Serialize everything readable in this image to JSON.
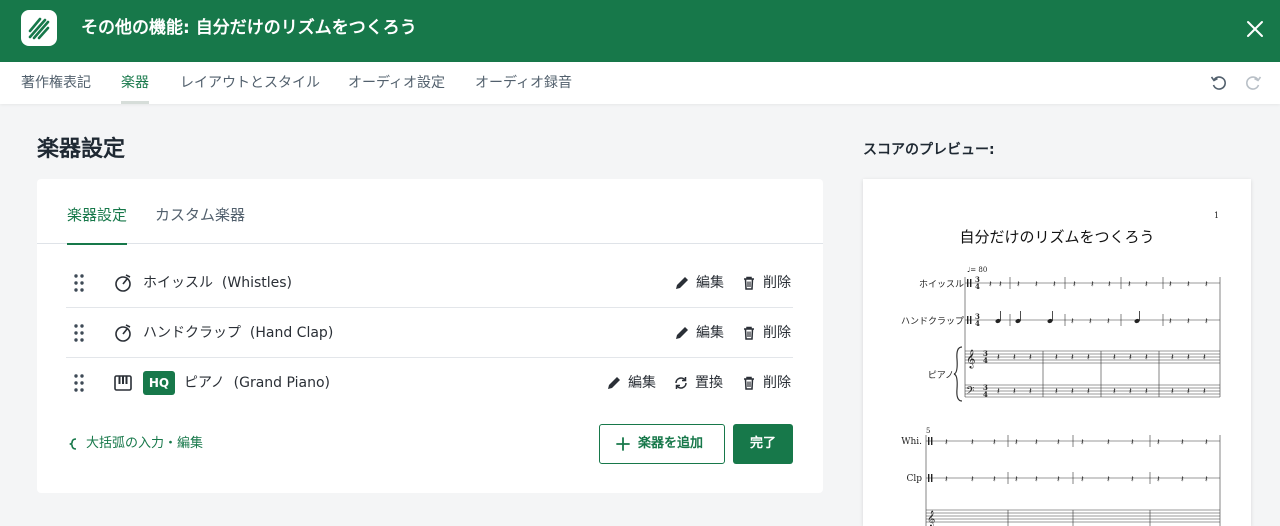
{
  "header": {
    "title": "その他の機能: 自分だけのリズムをつくろう",
    "logo_icon": "score-logo-icon",
    "close_icon": "close-icon",
    "bg_color": "#17784a"
  },
  "tabs": [
    {
      "label": "著作権表記",
      "active": false
    },
    {
      "label": "楽器",
      "active": true
    },
    {
      "label": "レイアウトとスタイル",
      "active": false
    },
    {
      "label": "オーディオ設定",
      "active": false
    },
    {
      "label": "オーディオ録音",
      "active": false
    }
  ],
  "toolbar": {
    "undo_icon": "undo-icon",
    "redo_icon": "redo-icon"
  },
  "instruments_panel": {
    "heading": "楽器設定",
    "subtabs": [
      {
        "label": "楽器設定",
        "active": true
      },
      {
        "label": "カスタム楽器",
        "active": false
      }
    ],
    "rows": [
      {
        "name": "ホイッスル",
        "english": "(Whistles)",
        "icon": "metronome-icon",
        "hq": false,
        "actions": [
          "編集",
          "削除"
        ]
      },
      {
        "name": "ハンドクラップ",
        "english": "(Hand Clap)",
        "icon": "metronome-icon",
        "hq": false,
        "actions": [
          "編集",
          "削除"
        ]
      },
      {
        "name": "ピアノ",
        "english": "(Grand Piano)",
        "icon": "piano-keys-icon",
        "hq": true,
        "hq_label": "HQ",
        "actions": [
          "編集",
          "置換",
          "削除"
        ]
      }
    ],
    "brace_link": "大括弧の入力・編集",
    "add_button": "楽器を追加",
    "done_button": "完了"
  },
  "preview": {
    "heading": "スコアのプレビュー:",
    "page_number": "1",
    "score_title": "自分だけのリズムをつくろう",
    "tempo": "♩= 80",
    "staff_labels_system1": [
      "ホイッスル",
      "ハンドクラップ",
      "ピアノ"
    ],
    "measure_number_system2": "5",
    "staff_labels_system2": [
      "Whi.",
      "Clp"
    ]
  }
}
